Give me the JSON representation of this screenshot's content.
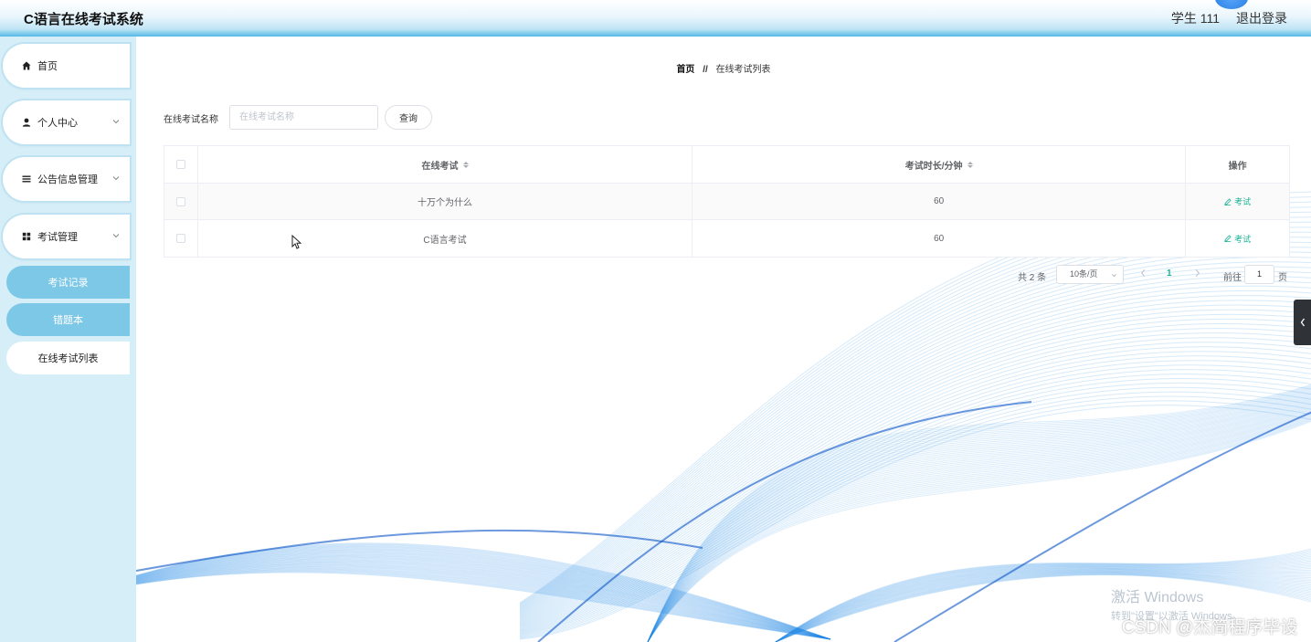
{
  "header": {
    "title": "C语言在线考试系统",
    "user": "学生 111",
    "logout": "退出登录"
  },
  "sidebar": {
    "items": [
      {
        "label": "首页",
        "icon": "home-icon"
      },
      {
        "label": "个人中心",
        "icon": "user-icon"
      },
      {
        "label": "公告信息管理",
        "icon": "list-icon"
      },
      {
        "label": "考试管理",
        "icon": "grid-icon"
      }
    ],
    "sub_items": [
      {
        "label": "考试记录"
      },
      {
        "label": "错题本"
      },
      {
        "label": "在线考试列表"
      }
    ]
  },
  "breadcrumb": {
    "home": "首页",
    "separator": "//",
    "current": "在线考试列表"
  },
  "search": {
    "label": "在线考试名称",
    "placeholder": "在线考试名称",
    "button": "查询"
  },
  "table": {
    "columns": [
      "在线考试",
      "考试时长/分钟",
      "操作"
    ],
    "rows": [
      {
        "name": "十万个为什么",
        "duration": "60",
        "action": "考试"
      },
      {
        "name": "C语言考试",
        "duration": "60",
        "action": "考试"
      }
    ]
  },
  "pagination": {
    "total": "共 2 条",
    "page_size": "10条/页",
    "current_page": "1",
    "goto_label": "前往",
    "goto_value": "1",
    "page_unit": "页"
  },
  "overlay": {
    "activate_title": "激活 Windows",
    "activate_sub": "转到\"设置\"以激活 Windows。",
    "watermark": "CSDN @杰简程序毕设"
  },
  "colors": {
    "header_accent": "#52b9e6",
    "sidebar_bg": "#d6eef8",
    "sub_item_active": "#7ec8e7",
    "link": "#19b394",
    "wave": "#1e88e5"
  }
}
